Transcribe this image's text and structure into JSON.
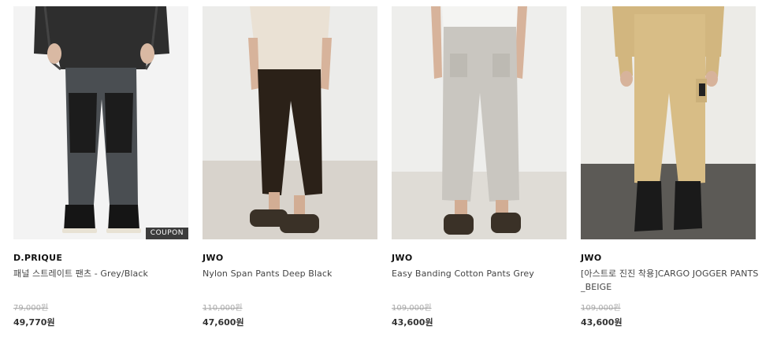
{
  "products": [
    {
      "brand": "D.PRIQUE",
      "name": "패널 스트레이트 팬츠 - Grey/Black",
      "original_price": "79,000원",
      "sale_price": "49,770원",
      "badge": "COUPON"
    },
    {
      "brand": "JWO",
      "name": "Nylon Span Pants Deep Black",
      "original_price": "110,000원",
      "sale_price": "47,600원"
    },
    {
      "brand": "JWO",
      "name": "Easy Banding Cotton Pants Grey",
      "original_price": "109,000원",
      "sale_price": "43,600원"
    },
    {
      "brand": "JWO",
      "name": "[아스트로 진진 착용]CARGO JOGGER PANTS_BEIGE",
      "original_price": "109,000원",
      "sale_price": "43,600원"
    }
  ]
}
